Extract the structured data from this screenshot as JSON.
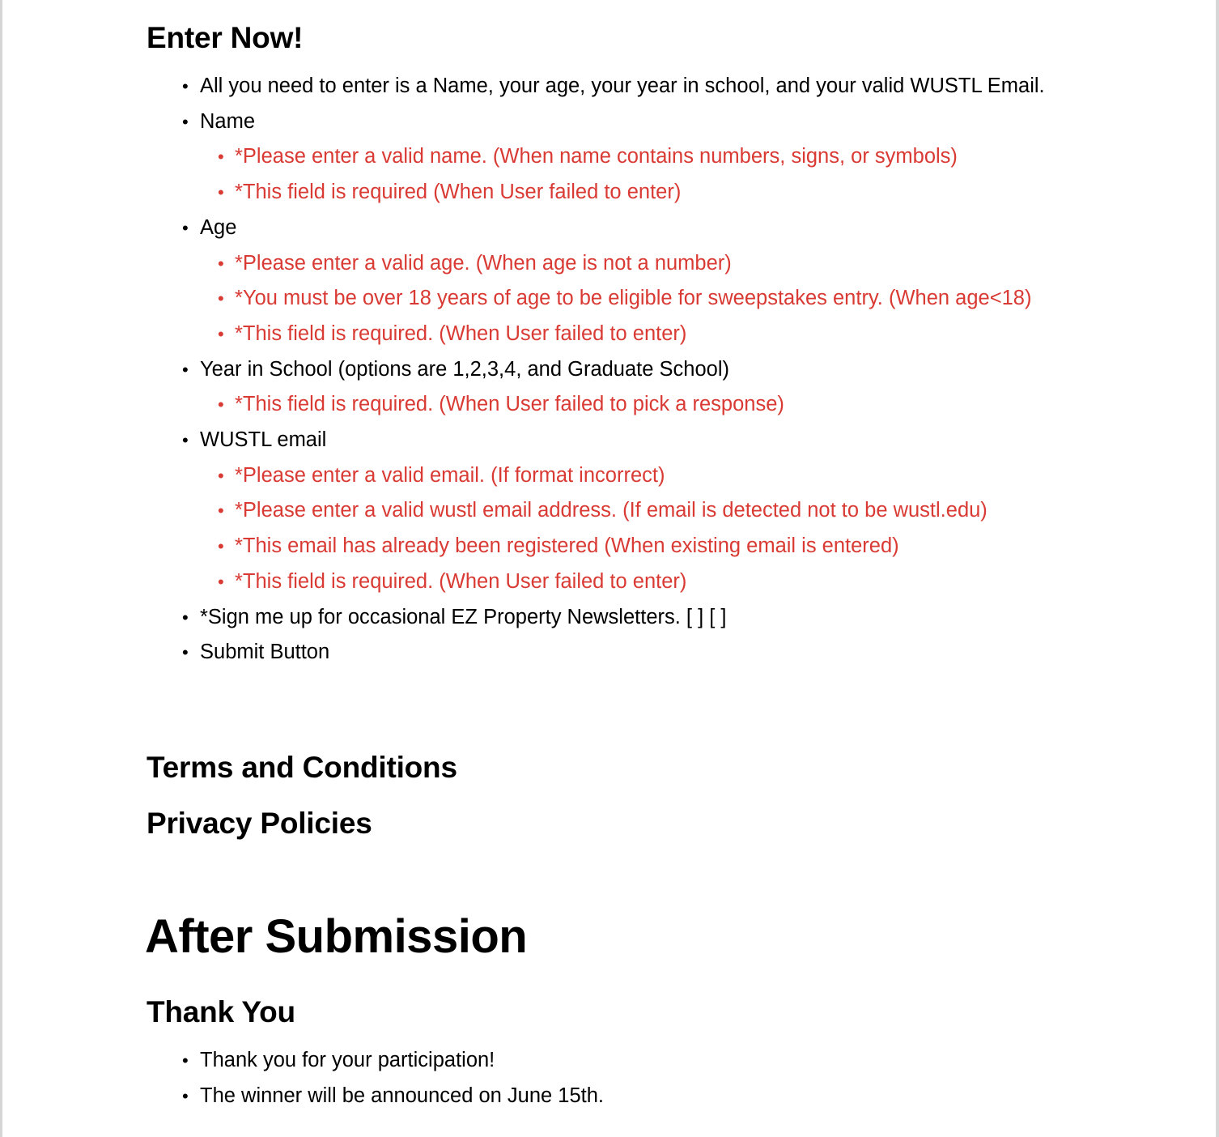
{
  "enter": {
    "heading": "Enter Now!",
    "items": [
      {
        "text": "All you need to enter is a Name, your age, your year in school, and your valid WUSTL Email.",
        "errors": []
      },
      {
        "text": "Name",
        "errors": [
          "*Please enter a valid name. (When name contains numbers, signs, or symbols)",
          "*This field is required (When User failed to enter)"
        ]
      },
      {
        "text": "Age",
        "errors": [
          "*Please enter a valid age. (When age is not a number)",
          "*You must be over 18 years of age to be eligible for sweepstakes entry. (When age<18)",
          "*This field is required. (When User failed to enter)"
        ]
      },
      {
        "text": "Year in School (options are 1,2,3,4, and Graduate School)",
        "errors": [
          "*This field is required. (When User failed to pick a response)"
        ]
      },
      {
        "text": "WUSTL email",
        "errors": [
          "*Please enter a valid email. (If format incorrect)",
          "*Please enter a valid wustl email address. (If email is detected not to be wustl.edu)",
          "*This email has already been registered (When existing email is entered)",
          "*This field is required. (When User failed to enter)"
        ]
      },
      {
        "text": "*Sign me up for occasional EZ Property Newsletters. [ ] [ ]",
        "errors": []
      },
      {
        "text": "Submit Button",
        "errors": []
      }
    ]
  },
  "terms": {
    "heading": "Terms and Conditions"
  },
  "privacy": {
    "heading": "Privacy Policies"
  },
  "after": {
    "heading": "After Submission"
  },
  "thanks": {
    "heading": "Thank You",
    "items": [
      "Thank you for your participation!",
      "The winner will be announced on June 15th."
    ]
  },
  "bullet_char": "•",
  "colors": {
    "error_text": "#d93a33",
    "body_text": "#000000"
  }
}
